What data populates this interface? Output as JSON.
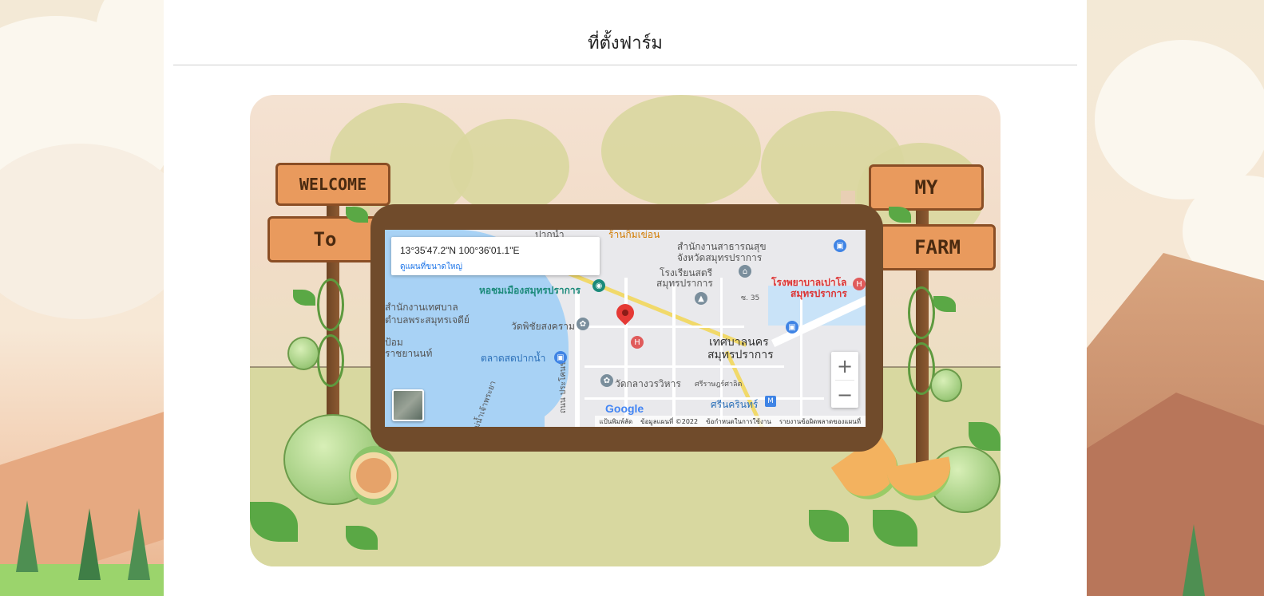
{
  "page": {
    "title": "ที่ตั้งฟาร์ม"
  },
  "signs": {
    "left_top": "WELCOME",
    "left_bottom": "To",
    "right_top": "MY",
    "right_bottom": "FARM"
  },
  "map": {
    "info_coords": "13°35'47.2\"N 100°36'01.1\"E",
    "info_link": "ดูแผนที่ขนาดใหญ่",
    "zoom_in": "+",
    "zoom_out": "−",
    "google_logo": "Google",
    "footer": {
      "shortcuts": "แป้นพิมพ์ลัด",
      "map_data": "ข้อมูลแผนที่ ©2022",
      "terms": "ข้อกำหนดในการใช้งาน",
      "report": "รายงานข้อผิดพลาดของแผนที่"
    },
    "labels": {
      "top_left": "ปากน้ำ",
      "top_orange": "ร้านกิมเข่อน",
      "health_office_1": "สำนักงานสาธารณสุข",
      "health_office_2": "จังหวัดสมุทรปราการ",
      "school_1": "โรงเรียนสตรี",
      "school_2": "สมุทรปราการ",
      "hospital_1": "โรงพยาบาลเปาโล",
      "hospital_2": "สมุทรปราการ",
      "tower": "หอชมเมืองสมุทรปราการ",
      "municipal_1": "สำนักงานเทศบาล",
      "municipal_2": "ตำบลพระสมุทรเจดีย์",
      "temple": "วัดพิชัยสงคราม",
      "market": "ตลาดสดปากน้ำ",
      "city_1": "เทศบาลนคร",
      "city_2": "สมุทรปราการ",
      "temple_2": "วัดกลางวรวิหาร",
      "station": "ศรีนครินทร์",
      "road": "ถนน ประโคนชัย",
      "river": "แม่น้ำเจ้าพระยา",
      "left_1": "ป้อม",
      "left_2": "ราชยานนท์",
      "soi": "ซ. 35",
      "road_2": "ศรีราษฎร์ศาลิต"
    }
  }
}
